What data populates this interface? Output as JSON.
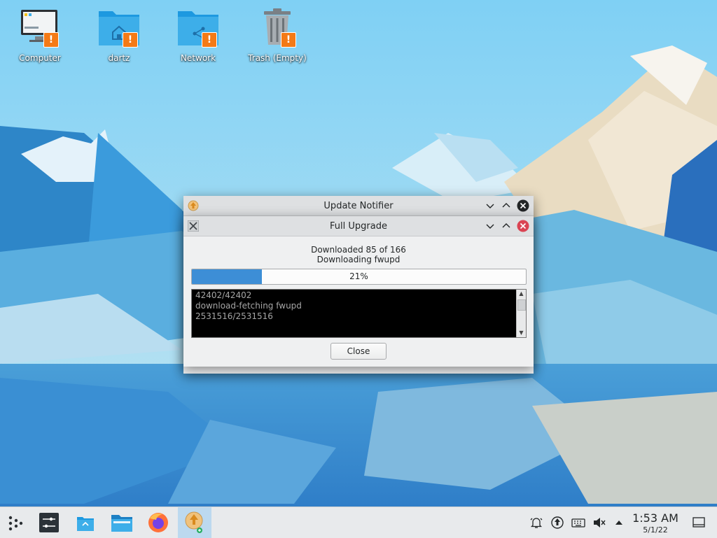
{
  "desktop": {
    "icons": [
      {
        "label": "Computer",
        "icon": "computer-icon"
      },
      {
        "label": "dartz",
        "icon": "home-folder-icon"
      },
      {
        "label": "Network",
        "icon": "network-folder-icon"
      },
      {
        "label": "Trash (Empty)",
        "icon": "trash-icon"
      }
    ],
    "badge_symbol": "!"
  },
  "windows": {
    "notifier": {
      "title": "Update Notifier"
    },
    "upgrade": {
      "title": "Full Upgrade",
      "status_line1": "Downloaded 85 of 166",
      "status_line2": "Downloading fwupd",
      "progress_percent": 21,
      "progress_label": "21%",
      "terminal_lines": [
        "42402/42402",
        "download-fetching fwupd",
        "2531516/2531516"
      ],
      "close_label": "Close"
    }
  },
  "taskbar": {
    "launchers": [
      "application-launcher-icon",
      "system-settings-icon",
      "discover-icon",
      "file-manager-icon",
      "firefox-icon",
      "update-notifier-icon"
    ],
    "tray": [
      "notifications-icon",
      "updates-icon",
      "keyboard-icon",
      "volume-muted-icon",
      "show-hidden-icons-icon"
    ],
    "clock_time": "1:53 AM",
    "clock_date": "5/1/22"
  },
  "colors": {
    "accent": "#3d8ed6",
    "warning": "#f47a16",
    "close_red": "#da4453"
  }
}
